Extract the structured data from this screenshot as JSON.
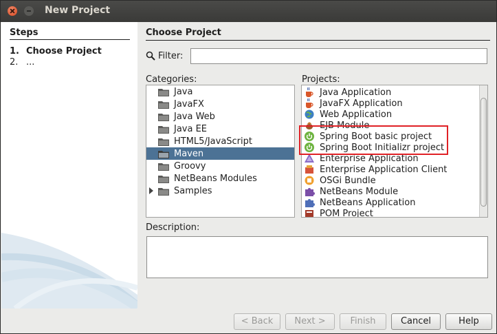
{
  "window": {
    "title": "New Project"
  },
  "steps": {
    "heading": "Steps",
    "items": [
      {
        "number": "1.",
        "label": "Choose Project",
        "current": true
      },
      {
        "number": "2.",
        "label": "...",
        "current": false
      }
    ]
  },
  "main": {
    "heading": "Choose Project",
    "filter": {
      "label": "Filter:",
      "value": "",
      "placeholder": ""
    },
    "categories": {
      "label": "Categories:",
      "items": [
        {
          "label": "Java",
          "selected": false,
          "expandable": false
        },
        {
          "label": "JavaFX",
          "selected": false,
          "expandable": false
        },
        {
          "label": "Java Web",
          "selected": false,
          "expandable": false
        },
        {
          "label": "Java EE",
          "selected": false,
          "expandable": false
        },
        {
          "label": "HTML5/JavaScript",
          "selected": false,
          "expandable": false
        },
        {
          "label": "Maven",
          "selected": true,
          "expandable": false
        },
        {
          "label": "Groovy",
          "selected": false,
          "expandable": false
        },
        {
          "label": "NetBeans Modules",
          "selected": false,
          "expandable": false
        },
        {
          "label": "Samples",
          "selected": false,
          "expandable": true
        }
      ]
    },
    "projects": {
      "label": "Projects:",
      "items": [
        {
          "label": "Java Application",
          "icon": "java-cup-icon"
        },
        {
          "label": "JavaFX Application",
          "icon": "java-cup-icon"
        },
        {
          "label": "Web Application",
          "icon": "globe-icon"
        },
        {
          "label": "EJB Module",
          "icon": "bean-icon"
        },
        {
          "label": "Spring Boot basic project",
          "icon": "spring-boot-icon"
        },
        {
          "label": "Spring Boot Initializr project",
          "icon": "spring-boot-icon"
        },
        {
          "label": "Enterprise Application",
          "icon": "triangle-icon"
        },
        {
          "label": "Enterprise Application Client",
          "icon": "app-client-icon"
        },
        {
          "label": "OSGi Bundle",
          "icon": "osgi-icon"
        },
        {
          "label": "NetBeans Module",
          "icon": "puzzle-icon"
        },
        {
          "label": "NetBeans Application",
          "icon": "puzzle-icon"
        },
        {
          "label": "POM Project",
          "icon": "pom-icon"
        }
      ]
    },
    "description": {
      "label": "Description:",
      "text": ""
    }
  },
  "buttons": {
    "back": "< Back",
    "next": "Next >",
    "finish": "Finish",
    "cancel": "Cancel",
    "help": "Help"
  },
  "colors": {
    "selection": "#4c7295",
    "highlight_box": "#e02025",
    "titlebar": "#3f3f3d"
  }
}
